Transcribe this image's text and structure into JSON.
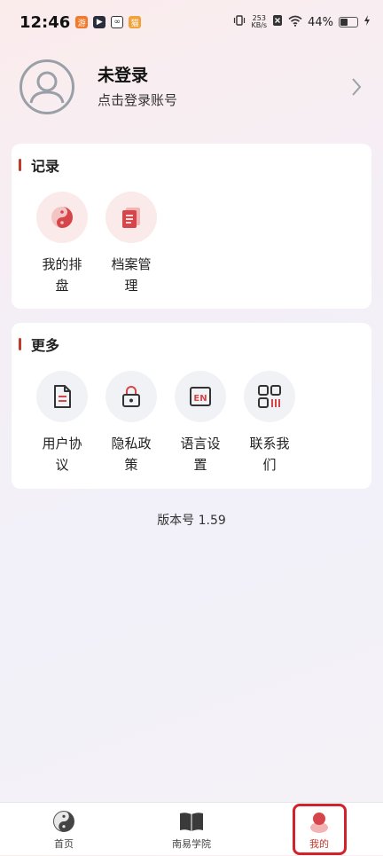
{
  "status_bar": {
    "time": "12:46",
    "net_speed_value": "253",
    "net_speed_unit": "KB/s",
    "battery": "44%"
  },
  "profile": {
    "name": "未登录",
    "subtitle": "点击登录账号"
  },
  "records": {
    "title": "记录",
    "items": [
      {
        "label": "我的排盘",
        "icon": "yin-yang-icon"
      },
      {
        "label": "档案管理",
        "icon": "documents-icon"
      }
    ]
  },
  "more": {
    "title": "更多",
    "items": [
      {
        "label": "用户协议",
        "icon": "document-icon"
      },
      {
        "label": "隐私政策",
        "icon": "lock-icon"
      },
      {
        "label": "语言设置",
        "icon": "language-en-icon"
      },
      {
        "label": "联系我们",
        "icon": "qr-code-icon"
      }
    ]
  },
  "version": "版本号 1.59",
  "bottom_nav": {
    "items": [
      {
        "label": "首页",
        "icon": "yin-yang-icon"
      },
      {
        "label": "南易学院",
        "icon": "book-icon"
      },
      {
        "label": "我的",
        "icon": "user-icon",
        "active": true
      }
    ]
  },
  "colors": {
    "accent": "#c0392b",
    "highlight": "#d3222a"
  }
}
